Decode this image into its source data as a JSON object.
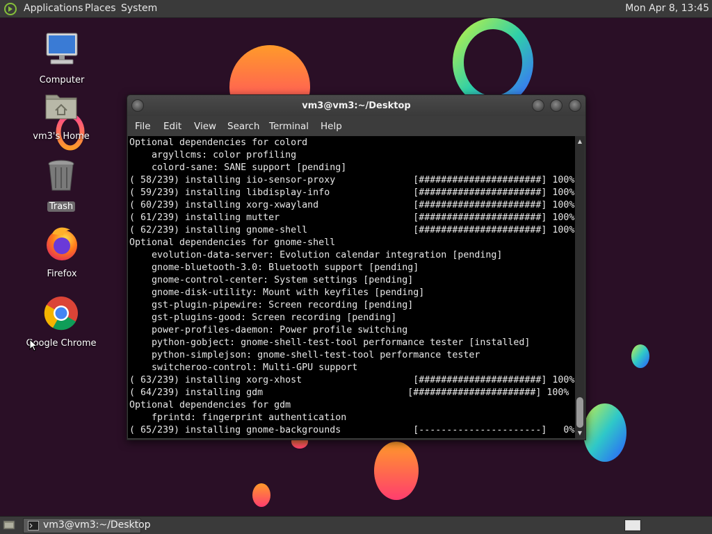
{
  "top_panel": {
    "menu": [
      "Applications",
      "Places",
      "System"
    ],
    "clock": "Mon Apr  8, 13:45"
  },
  "desktop": {
    "icons": [
      {
        "label": "Computer",
        "icon": "computer-icon"
      },
      {
        "label": "vm3's Home",
        "icon": "home-folder-icon"
      },
      {
        "label": "Trash",
        "icon": "trash-icon"
      },
      {
        "label": "Firefox",
        "icon": "firefox-icon"
      },
      {
        "label": "Google Chrome",
        "icon": "chrome-icon"
      }
    ]
  },
  "terminal": {
    "title": "vm3@vm3:~/Desktop",
    "menu": [
      "File",
      "Edit",
      "View",
      "Search",
      "Terminal",
      "Help"
    ],
    "lines": [
      "Optional dependencies for colord",
      "    argyllcms: color profiling",
      "    colord-sane: SANE support [pending]",
      "( 58/239) installing iio-sensor-proxy              [######################] 100%",
      "( 59/239) installing libdisplay-info               [######################] 100%",
      "( 60/239) installing xorg-xwayland                 [######################] 100%",
      "( 61/239) installing mutter                        [######################] 100%",
      "( 62/239) installing gnome-shell                   [######################] 100%",
      "Optional dependencies for gnome-shell",
      "    evolution-data-server: Evolution calendar integration [pending]",
      "    gnome-bluetooth-3.0: Bluetooth support [pending]",
      "    gnome-control-center: System settings [pending]",
      "    gnome-disk-utility: Mount with keyfiles [pending]",
      "    gst-plugin-pipewire: Screen recording [pending]",
      "    gst-plugins-good: Screen recording [pending]",
      "    power-profiles-daemon: Power profile switching",
      "    python-gobject: gnome-shell-test-tool performance tester [installed]",
      "    python-simplejson: gnome-shell-test-tool performance tester",
      "    switcheroo-control: Multi-GPU support",
      "( 63/239) installing xorg-xhost                    [######################] 100%",
      "( 64/239) installing gdm                          [######################] 100%",
      "Optional dependencies for gdm",
      "    fprintd: fingerprint authentication",
      "( 65/239) installing gnome-backgrounds             [----------------------]   0%"
    ]
  },
  "taskbar": {
    "window_button": "vm3@vm3:~/Desktop"
  },
  "colors": {
    "panel": "#3a3a3a",
    "desktop_bg": "#2a0f26",
    "terminal_bg": "#000000",
    "terminal_fg": "#e8e8e8"
  }
}
